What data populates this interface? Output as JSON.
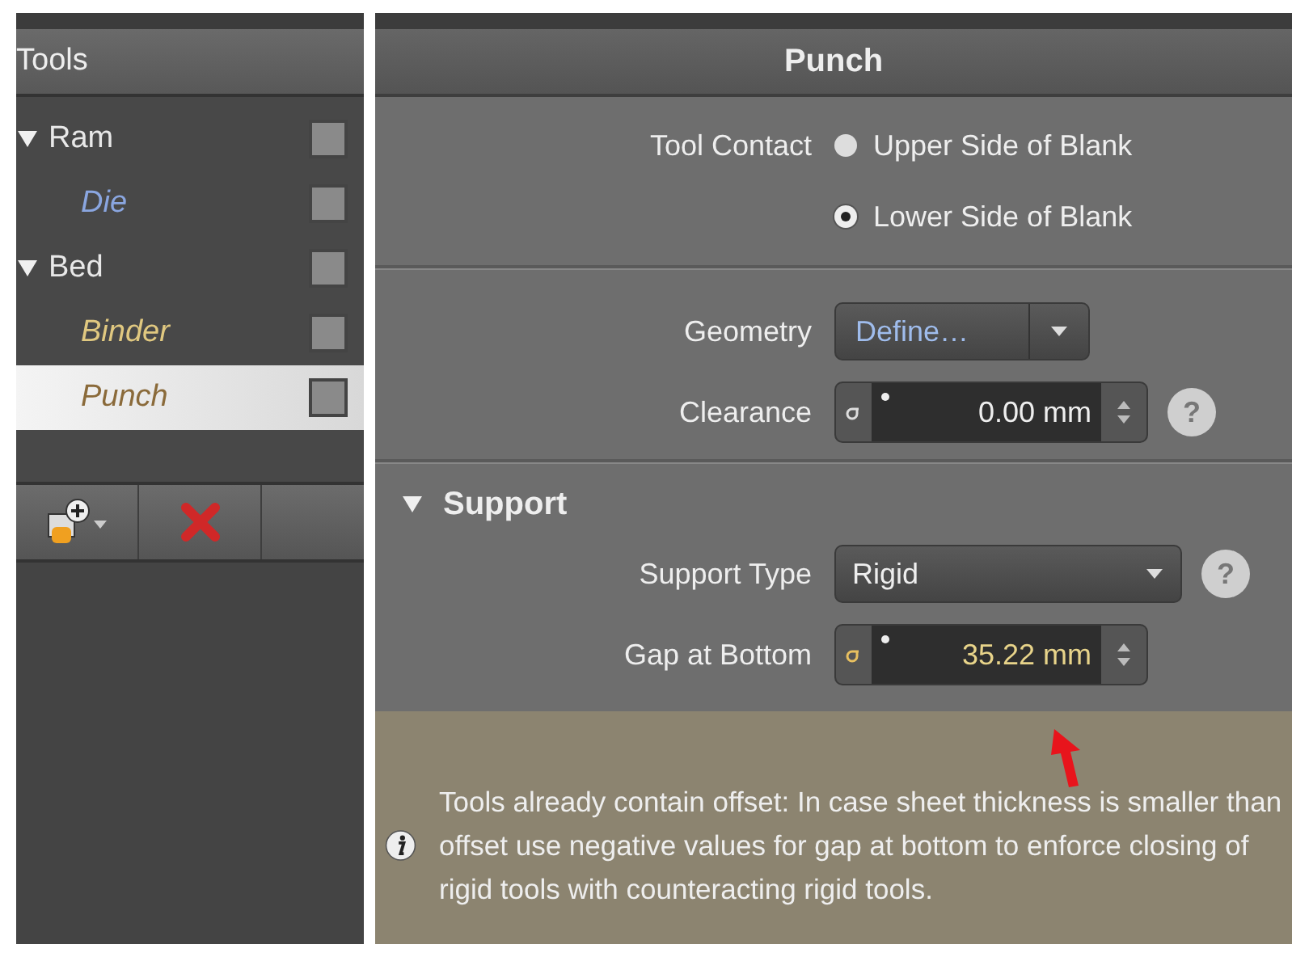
{
  "sidebar": {
    "title": "Tools",
    "items": [
      {
        "label": "Ram",
        "expanded": true,
        "checked": false,
        "selected": false,
        "children": [
          {
            "label": "Die",
            "color": "#8aa6e0",
            "checked": false,
            "selected": false
          }
        ]
      },
      {
        "label": "Bed",
        "expanded": true,
        "checked": false,
        "selected": false,
        "children": [
          {
            "label": "Binder",
            "color": "#e0c880",
            "checked": false,
            "selected": false
          },
          {
            "label": "Punch",
            "color": "#8a6a3a",
            "checked": false,
            "selected": true
          }
        ]
      }
    ]
  },
  "panel": {
    "title": "Punch",
    "tool_contact": {
      "label": "Tool Contact",
      "options": [
        {
          "label": "Upper Side of Blank",
          "selected": false
        },
        {
          "label": "Lower Side of Blank",
          "selected": true
        }
      ]
    },
    "geometry": {
      "label": "Geometry",
      "value": "Define…"
    },
    "clearance": {
      "label": "Clearance",
      "value": "0.00 mm",
      "modified": false,
      "help": "?"
    },
    "support": {
      "title": "Support",
      "expanded": true,
      "support_type": {
        "label": "Support Type",
        "value": "Rigid",
        "help": "?"
      },
      "gap_at_bottom": {
        "label": "Gap at Bottom",
        "value": "35.22 mm",
        "modified": true
      }
    },
    "info": "Tools already contain offset: In case sheet thickness is smaller than offset use negative values for gap at bottom to enforce closing of rigid tools with counteracting rigid tools."
  }
}
